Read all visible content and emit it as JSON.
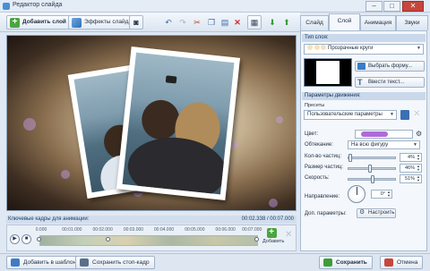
{
  "window": {
    "title": "Редактор слайда",
    "min": "–",
    "max": "□",
    "close": "✕"
  },
  "toolbar": {
    "add_layer": "Добавить слой",
    "slide_effects": "Эффекты слайда"
  },
  "tabs": [
    "Слайд",
    "Слой",
    "Анимация",
    "Звуки"
  ],
  "layer_type": {
    "header": "Тип слоя:",
    "shape_value": "Прозрачные круги",
    "choose_shape": "Выбрать форму...",
    "enter_text": "Ввести текст..."
  },
  "motion": {
    "header": "Параметры движения:",
    "presets_label": "Пресеты",
    "preset_value": "Пользовательские параметры",
    "color_label": "Цвет:",
    "wrap_label": "Обтекание:",
    "wrap_value": "На всю фигуру",
    "count_label": "Кол-во частиц:",
    "count_value": "4%",
    "count_level": 0.04,
    "size_label": "Размер частиц:",
    "size_value": "46%",
    "size_level": 0.46,
    "speed_label": "Скорость:",
    "speed_value": "51%",
    "speed_level": 0.51,
    "direction_label": "Направление:",
    "direction_value": "0°",
    "extra_label": "Доп. параметры:",
    "configure": "Настроить",
    "accent": "#b06ad8"
  },
  "timeline": {
    "title": "Ключевые кадры для анимации:",
    "time": "00:02.338 / 00:07.000",
    "ticks": [
      "0.000",
      "00:01.000",
      "00:02.000",
      "00:03.000",
      "00:04.000",
      "00:05.000",
      "00:06.000",
      "00:07.000"
    ],
    "add_label": "Добавить"
  },
  "bottom": {
    "add_to_templates": "Добавить в шаблоны",
    "save_stop_frame": "Сохранить стоп-кадр",
    "save": "Сохранить",
    "cancel": "Отмена"
  }
}
